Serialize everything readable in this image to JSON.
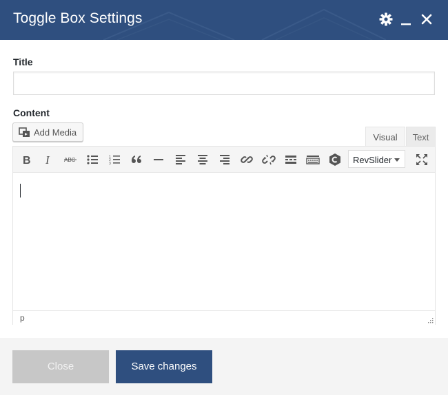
{
  "dialog": {
    "title": "Toggle Box Settings",
    "header_icons": [
      "gear-icon",
      "minimize-icon",
      "close-icon"
    ]
  },
  "form": {
    "title_label": "Title",
    "title_value": "",
    "content_label": "Content"
  },
  "editor": {
    "add_media_label": "Add Media",
    "tabs": {
      "visual": "Visual",
      "text": "Text"
    },
    "active_tab": "Visual",
    "toolbar_icons": [
      "bold-icon",
      "italic-icon",
      "strikethrough-icon",
      "bullet-list-icon",
      "numbered-list-icon",
      "blockquote-icon",
      "horizontal-rule-icon",
      "align-left-icon",
      "align-center-icon",
      "align-right-icon",
      "link-icon",
      "unlink-icon",
      "read-more-icon",
      "toolbar-toggle-icon",
      "shortcode-icon",
      "fullscreen-icon"
    ],
    "dropdown_value": "RevSlider",
    "status_path": "p"
  },
  "footer": {
    "close_label": "Close",
    "save_label": "Save changes"
  },
  "colors": {
    "header_bg": "#2f4f7f",
    "save_bg": "#2f4f7f",
    "close_bg": "#c7c7c7",
    "footer_bg": "#f4f4f4"
  }
}
